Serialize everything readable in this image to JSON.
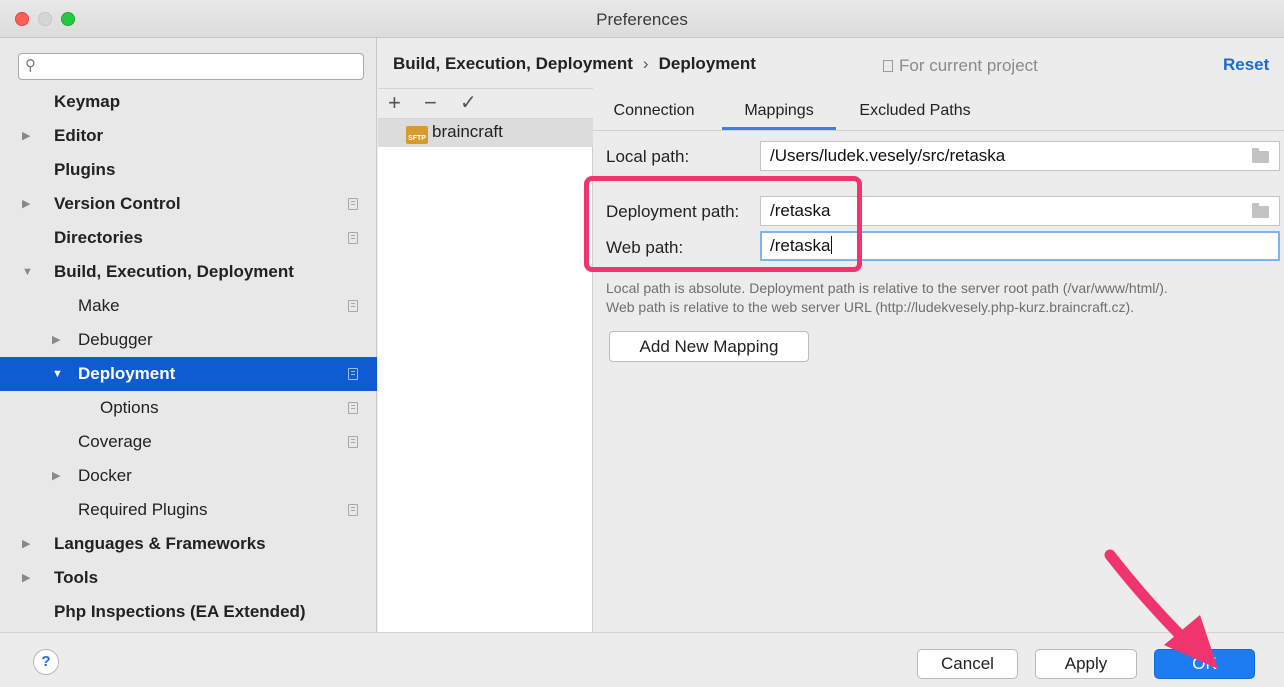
{
  "window": {
    "title": "Preferences"
  },
  "sidebar": {
    "search_placeholder": "",
    "items": [
      {
        "label": "Keymap",
        "bold": true,
        "expand": "",
        "indent": 0,
        "copy": false
      },
      {
        "label": "Editor",
        "bold": true,
        "expand": "collapsed",
        "indent": 0,
        "copy": false
      },
      {
        "label": "Plugins",
        "bold": true,
        "expand": "",
        "indent": 0,
        "copy": false
      },
      {
        "label": "Version Control",
        "bold": true,
        "expand": "collapsed",
        "indent": 0,
        "copy": true
      },
      {
        "label": "Directories",
        "bold": true,
        "expand": "",
        "indent": 0,
        "copy": true
      },
      {
        "label": "Build, Execution, Deployment",
        "bold": true,
        "expand": "expanded",
        "indent": 0,
        "copy": false
      },
      {
        "label": "Make",
        "bold": false,
        "expand": "",
        "indent": 1,
        "copy": true
      },
      {
        "label": "Debugger",
        "bold": false,
        "expand": "collapsed",
        "indent": 1,
        "copy": false
      },
      {
        "label": "Deployment",
        "bold": true,
        "expand": "expanded",
        "indent": 1,
        "copy": true,
        "selected": true
      },
      {
        "label": "Options",
        "bold": false,
        "expand": "",
        "indent": 2,
        "copy": true
      },
      {
        "label": "Coverage",
        "bold": false,
        "expand": "",
        "indent": 1,
        "copy": true
      },
      {
        "label": "Docker",
        "bold": false,
        "expand": "collapsed",
        "indent": 1,
        "copy": false
      },
      {
        "label": "Required Plugins",
        "bold": false,
        "expand": "",
        "indent": 1,
        "copy": true
      },
      {
        "label": "Languages & Frameworks",
        "bold": true,
        "expand": "collapsed",
        "indent": 0,
        "copy": false
      },
      {
        "label": "Tools",
        "bold": true,
        "expand": "collapsed",
        "indent": 0,
        "copy": false
      },
      {
        "label": "Php Inspections (EA Extended)",
        "bold": true,
        "expand": "",
        "indent": 0,
        "copy": false
      }
    ]
  },
  "header": {
    "breadcrumb_parent": "Build, Execution, Deployment",
    "breadcrumb_separator": "›",
    "breadcrumb_current": "Deployment",
    "scope_label": "For current project",
    "reset_label": "Reset"
  },
  "servers": {
    "add_label": "+",
    "remove_label": "−",
    "default_label": "✓",
    "icon_label": "SFTP",
    "items": [
      {
        "name": "braincraft"
      }
    ]
  },
  "tabs": [
    {
      "label": "Connection"
    },
    {
      "label": "Mappings"
    },
    {
      "label": "Excluded Paths"
    }
  ],
  "mappings": {
    "local_path_label": "Local path:",
    "local_path_value": "/Users/ludek.vesely/src/retaska",
    "deployment_path_label": "Deployment path:",
    "deployment_path_value": "/retaska",
    "web_path_label": "Web path:",
    "web_path_value": "/retaska",
    "help_line1": "Local path is absolute. Deployment path is relative to the server root path (/var/www/html/).",
    "help_line2": "Web path is relative to the web server URL (http://ludekvesely.php-kurz.braincraft.cz).",
    "add_mapping_label": "Add New Mapping"
  },
  "footer": {
    "help_label": "?",
    "cancel_label": "Cancel",
    "apply_label": "Apply",
    "ok_label": "OK"
  },
  "colors": {
    "selection": "#0f5bd2",
    "accent_link": "#1a6cd4",
    "ok_button": "#1e7cf2",
    "annotation": "#f0346e"
  }
}
